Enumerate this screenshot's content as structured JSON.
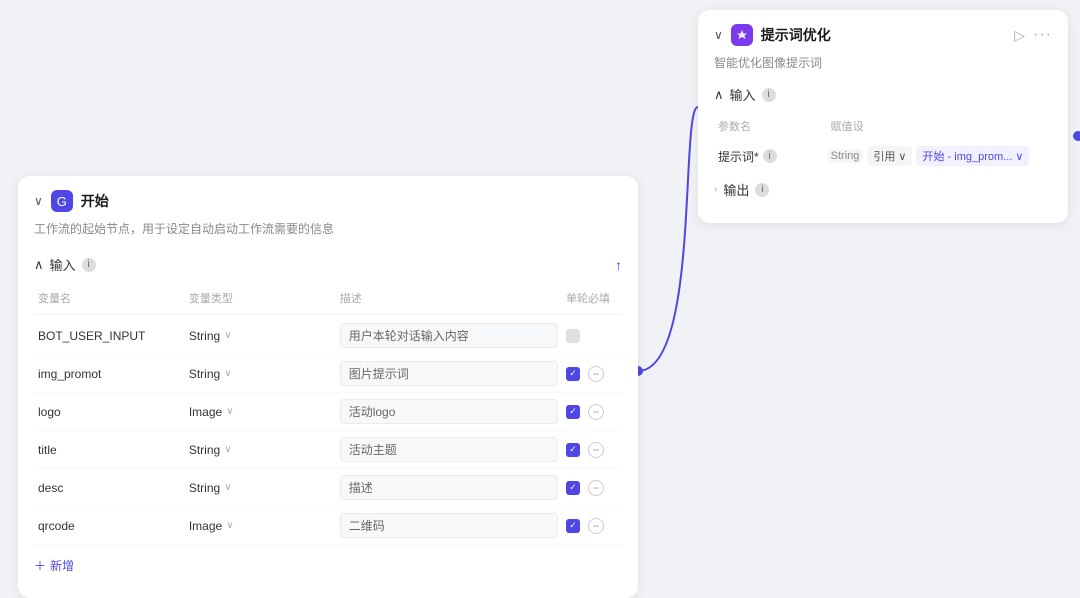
{
  "startCard": {
    "title": "开始",
    "subtitle": "工作流的起始节点，用于设定自动启动工作流需要的信息",
    "inputSectionLabel": "输入",
    "columns": {
      "varName": "变量名",
      "varType": "变量类型",
      "description": "描述",
      "required": "单轮必填"
    },
    "rows": [
      {
        "varName": "BOT_USER_INPUT",
        "varType": "String",
        "description": "用户本轮对话输入内容",
        "required": false,
        "removable": false
      },
      {
        "varName": "img_promot",
        "varType": "String",
        "description": "图片提示词",
        "required": true,
        "removable": true
      },
      {
        "varName": "logo",
        "varType": "Image",
        "description": "活动logo",
        "required": true,
        "removable": true
      },
      {
        "varName": "title",
        "varType": "String",
        "description": "活动主题",
        "required": true,
        "removable": true
      },
      {
        "varName": "desc",
        "varType": "String",
        "description": "描述",
        "required": true,
        "removable": true
      },
      {
        "varName": "qrcode",
        "varType": "Image",
        "description": "二维码",
        "required": true,
        "removable": true
      }
    ],
    "addButtonLabel": "新增"
  },
  "promptCard": {
    "title": "提示词优化",
    "subtitle": "智能优化图像提示词",
    "inputSectionLabel": "输入",
    "params": {
      "nameHeader": "参数名",
      "valueHeader": "赋值设"
    },
    "inputRows": [
      {
        "name": "提示词*",
        "type": "String",
        "refLabel": "引用",
        "valueLabel": "开始 - img_prom..."
      }
    ],
    "outputSectionLabel": "输出"
  },
  "icons": {
    "collapse": "∨",
    "chevronDown": "∨",
    "chevronRight": "›",
    "info": "i",
    "plus": "+",
    "minus": "—",
    "export": "⬆",
    "playCircle": "▷",
    "more": "···",
    "startNodeIcon": "G",
    "promptNodeIcon": "✦"
  }
}
